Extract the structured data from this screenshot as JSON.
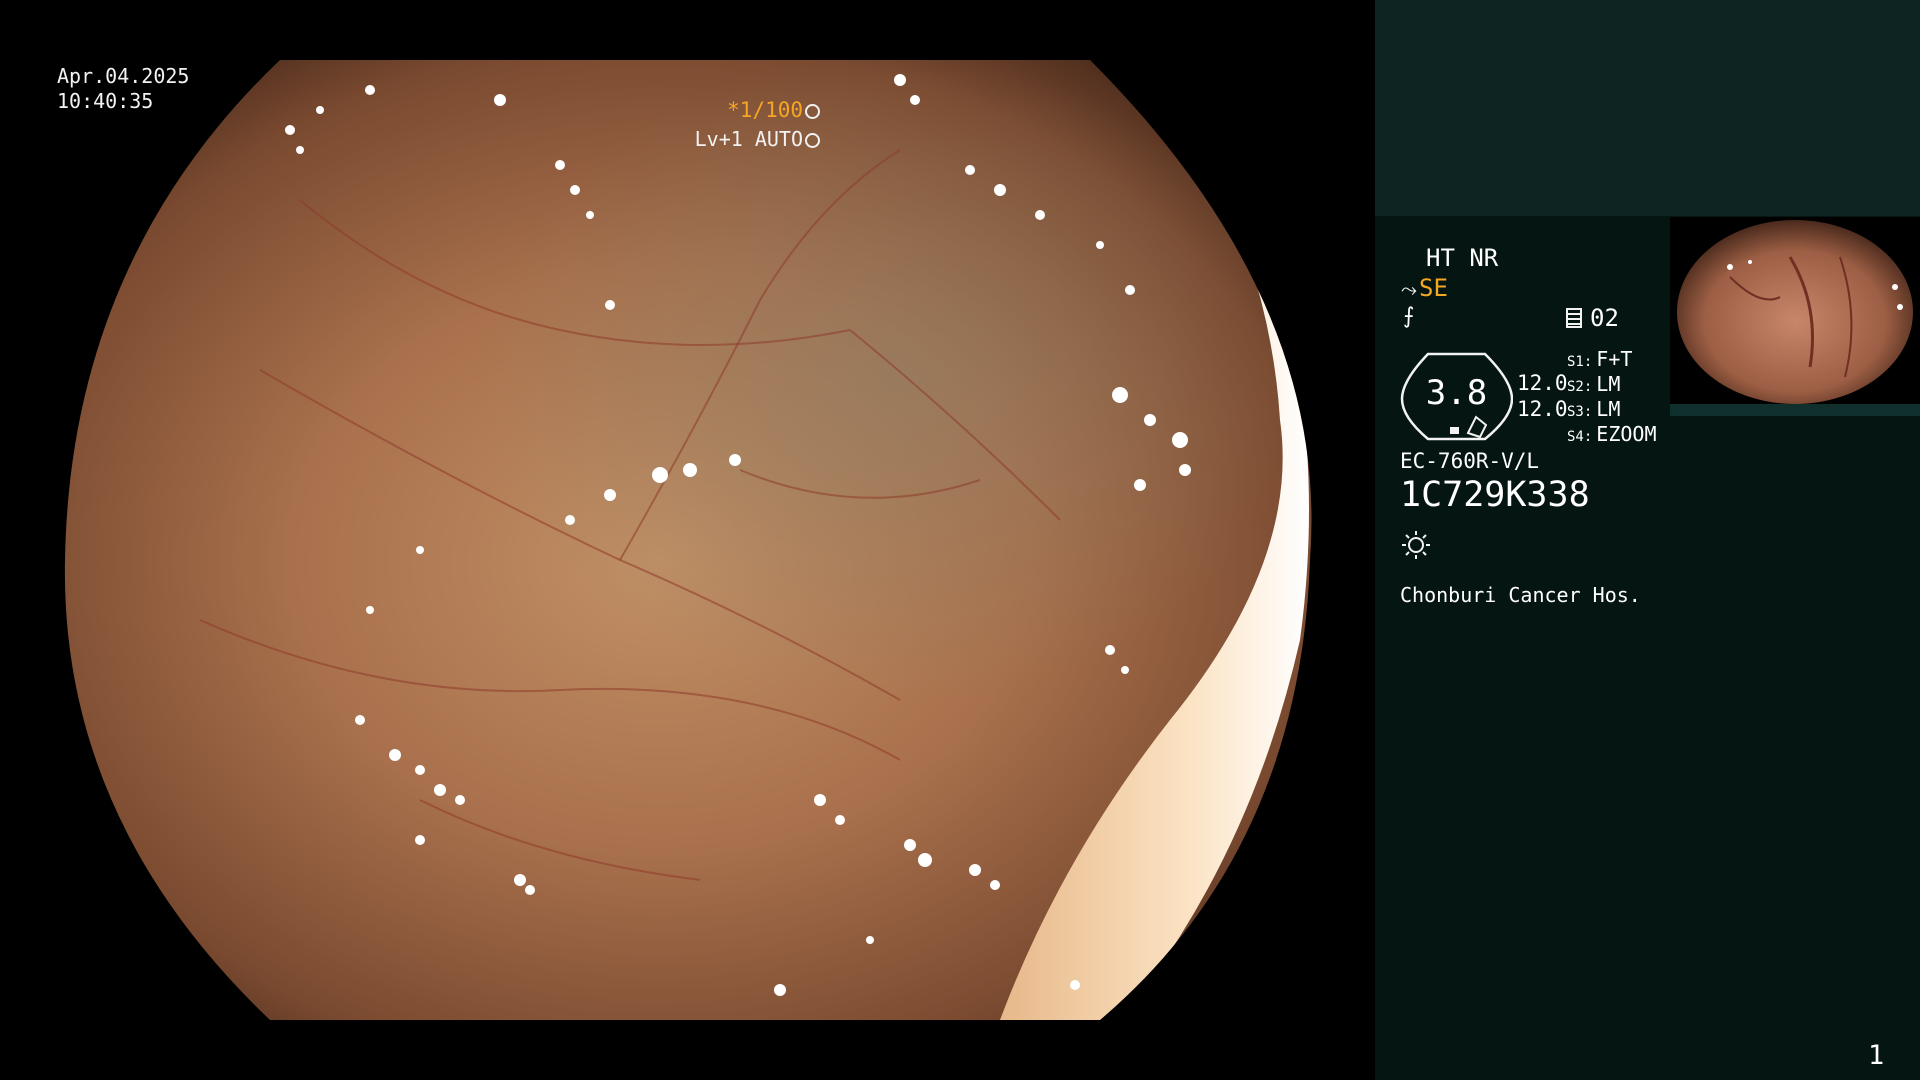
{
  "overlay": {
    "date": "Apr.04.2025",
    "time": "10:40:35",
    "shutter": "*1/100",
    "shutter_icon": "aperture-icon",
    "level": "Lv+1 AUTO",
    "level_icon": "target-icon"
  },
  "panel": {
    "ht_nr": "HT NR",
    "structure_mode": "SE",
    "preset_icon": "memo-icon",
    "preset": "02",
    "gauge_value": "3.8",
    "gauge_num_1": "12.0",
    "gauge_num_2": "12.0",
    "switches": [
      {
        "key": "S1:",
        "value": "F+T"
      },
      {
        "key": "S2:",
        "value": "LM"
      },
      {
        "key": "S3:",
        "value": "LM"
      },
      {
        "key": "S4:",
        "value": "EZOOM"
      }
    ],
    "scope_model": "EC-760R-V/L",
    "serial": "1C729K338",
    "light_icon": "sun-icon",
    "hospital": "Chonburi Cancer Hos.",
    "page_number": "1"
  },
  "colors": {
    "accent_orange": "#f5a623",
    "panel_bg": "#051512",
    "panel_top_bg": "#0d2423",
    "text": "#ffffff"
  }
}
